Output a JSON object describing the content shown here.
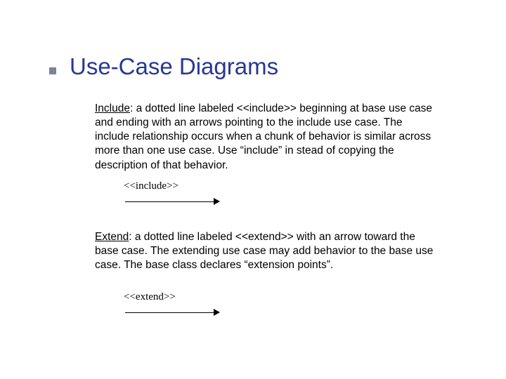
{
  "title": "Use-Case Diagrams",
  "include": {
    "label": "Include",
    "text": ": a dotted line labeled <<include>> beginning at base use case and ending with an arrows pointing to the include use case.  The include relationship occurs when a chunk of behavior is similar across more than one use case. Use “include” in stead of copying the description of that behavior.",
    "arrow_label": "<<include>>"
  },
  "extend": {
    "label": "Extend",
    "text": ": a dotted line labeled <<extend>>  with an arrow toward the base case. The extending use case may add behavior to the base use case. The base class declares “extension points”.",
    "arrow_label": "<<extend>>"
  }
}
